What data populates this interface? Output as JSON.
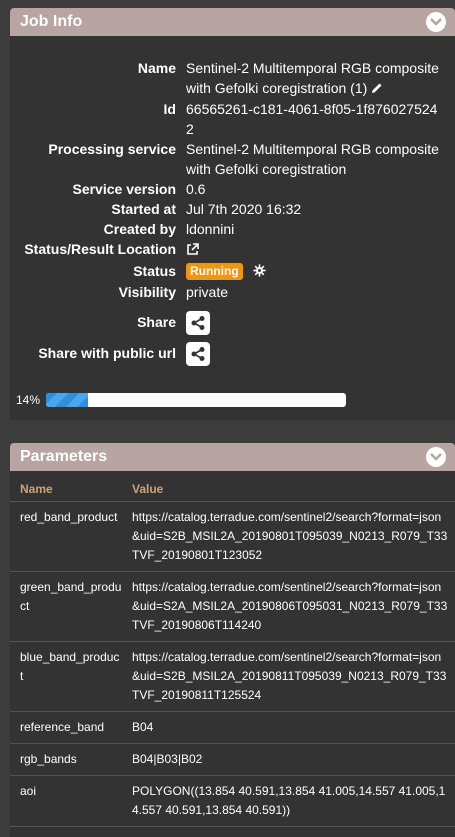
{
  "job": {
    "title": "Job Info",
    "rows": [
      {
        "label": "Name",
        "value": "Sentinel-2 Multitemporal RGB composite with Gefolki coregistration (1)"
      },
      {
        "label": "Id",
        "value": "66565261-c181-4061-8f05-1f8760275242"
      },
      {
        "label": "Processing service",
        "value": "Sentinel-2 Multitemporal RGB composite with Gefolki coregistration"
      },
      {
        "label": "Service version",
        "value": "0.6"
      },
      {
        "label": "Started at",
        "value": "Jul 7th 2020 16:32"
      },
      {
        "label": "Created by",
        "value": "ldonnini"
      },
      {
        "label": "Status/Result Location",
        "value": ""
      },
      {
        "label": "Status",
        "value": "Running"
      },
      {
        "label": "Visibility",
        "value": "private"
      },
      {
        "label": "Share",
        "value": ""
      },
      {
        "label": "Share with public url",
        "value": ""
      }
    ],
    "progress": {
      "label": "14%",
      "fraction": 0.14
    },
    "colors": {
      "header": "#b7a4a3",
      "badge": "#f0950d",
      "progress": "#2e8fdc"
    },
    "icons": [
      "pencil-icon",
      "external-link-icon",
      "gear-icon",
      "share-icon",
      "chevron-down-icon"
    ]
  },
  "params": {
    "title": "Parameters",
    "columns": [
      "Name",
      "Value"
    ],
    "rows": [
      {
        "name": "red_band_product",
        "value": "https://catalog.terradue.com/sentinel2/search?format=json&uid=S2B_MSIL2A_20190801T095039_N0213_R079_T33TVF_20190801T123052"
      },
      {
        "name": "green_band_product",
        "value": "https://catalog.terradue.com/sentinel2/search?format=json&uid=S2A_MSIL2A_20190806T095031_N0213_R079_T33TVF_20190806T114240"
      },
      {
        "name": "blue_band_product",
        "value": "https://catalog.terradue.com/sentinel2/search?format=json&uid=S2B_MSIL2A_20190811T095039_N0213_R079_T33TVF_20190811T125524"
      },
      {
        "name": "reference_band",
        "value": "B04"
      },
      {
        "name": "rgb_bands",
        "value": "B04|B03|B02"
      },
      {
        "name": "aoi",
        "value": "POLYGON((13.854 40.591,13.854 41.005,14.557 41.005,14.557 40.591,13.854 40.591))"
      }
    ]
  }
}
